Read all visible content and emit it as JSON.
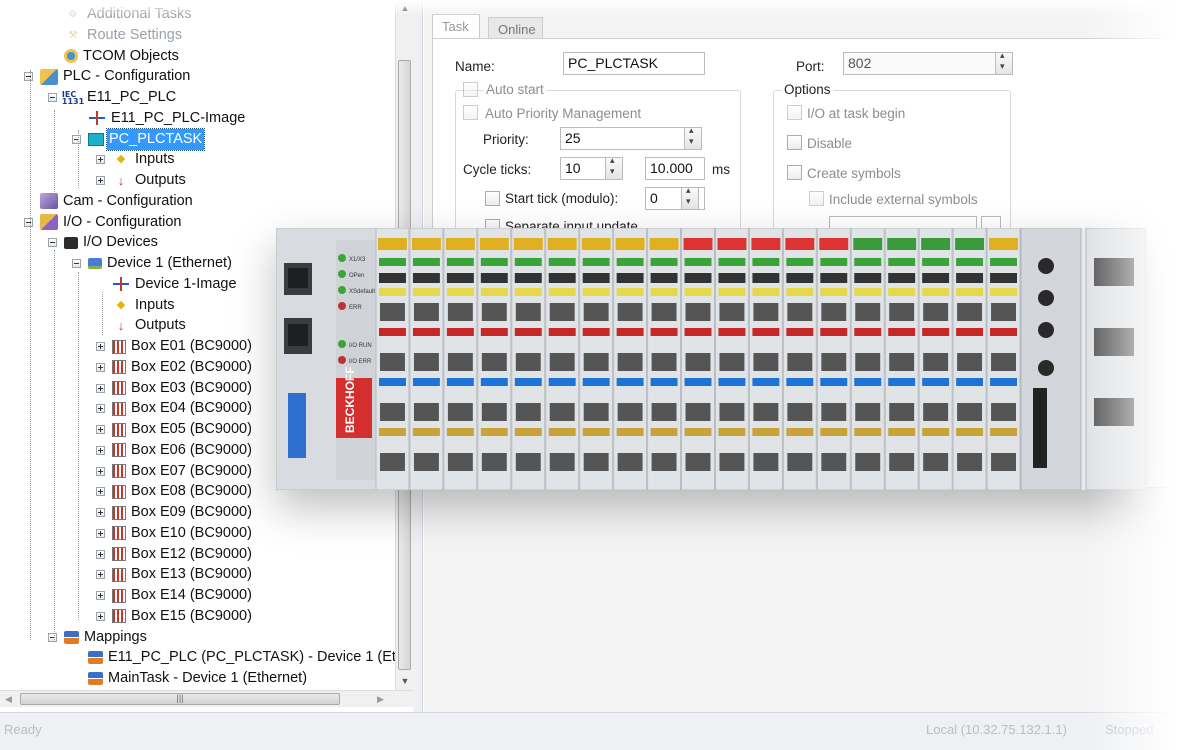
{
  "tree": {
    "items": [
      {
        "label": "Additional Tasks",
        "icon": "additional-tasks-icon"
      },
      {
        "label": "Route Settings",
        "icon": "route-settings-icon"
      },
      {
        "label": "TCOM Objects",
        "icon": "tcom-objects-icon"
      },
      {
        "label": "PLC - Configuration",
        "icon": "plc-configuration-icon"
      },
      {
        "label": "E11_PC_PLC",
        "icon": "iec-project-icon"
      },
      {
        "label": "E11_PC_PLC-Image",
        "icon": "process-image-icon"
      },
      {
        "label": "PC_PLCTASK",
        "icon": "plc-task-icon",
        "selected": true
      },
      {
        "label": "Inputs",
        "icon": "inputs-icon"
      },
      {
        "label": "Outputs",
        "icon": "outputs-icon"
      },
      {
        "label": "Cam - Configuration",
        "icon": "cam-configuration-icon"
      },
      {
        "label": "I/O - Configuration",
        "icon": "io-configuration-icon"
      },
      {
        "label": "I/O Devices",
        "icon": "io-devices-icon"
      },
      {
        "label": "Device 1 (Ethernet)",
        "icon": "ethernet-device-icon"
      },
      {
        "label": "Device 1-Image",
        "icon": "process-image-icon"
      },
      {
        "label": "Inputs",
        "icon": "inputs-icon"
      },
      {
        "label": "Outputs",
        "icon": "outputs-icon"
      },
      {
        "label": "Box E01 (BC9000)",
        "icon": "bus-coupler-icon"
      },
      {
        "label": "Box E02 (BC9000)",
        "icon": "bus-coupler-icon"
      },
      {
        "label": "Box E03 (BC9000)",
        "icon": "bus-coupler-icon"
      },
      {
        "label": "Box E04 (BC9000)",
        "icon": "bus-coupler-icon"
      },
      {
        "label": "Box E05 (BC9000)",
        "icon": "bus-coupler-icon"
      },
      {
        "label": "Box E06 (BC9000)",
        "icon": "bus-coupler-icon"
      },
      {
        "label": "Box E07 (BC9000)",
        "icon": "bus-coupler-icon"
      },
      {
        "label": "Box E08 (BC9000)",
        "icon": "bus-coupler-icon"
      },
      {
        "label": "Box E09 (BC9000)",
        "icon": "bus-coupler-icon"
      },
      {
        "label": "Box E10 (BC9000)",
        "icon": "bus-coupler-icon"
      },
      {
        "label": "Box E12 (BC9000)",
        "icon": "bus-coupler-icon"
      },
      {
        "label": "Box E13 (BC9000)",
        "icon": "bus-coupler-icon"
      },
      {
        "label": "Box E14 (BC9000)",
        "icon": "bus-coupler-icon"
      },
      {
        "label": "Box E15 (BC9000)",
        "icon": "bus-coupler-icon"
      },
      {
        "label": "Mappings",
        "icon": "mappings-icon"
      },
      {
        "label": "E11_PC_PLC (PC_PLCTASK) - Device 1 (Eth",
        "icon": "mapping-icon"
      },
      {
        "label": "MainTask - Device 1 (Ethernet)",
        "icon": "mapping-icon"
      }
    ]
  },
  "tabs": [
    {
      "label": "Task",
      "active": true
    },
    {
      "label": "Online",
      "active": false
    }
  ],
  "form": {
    "name_label": "Name:",
    "name_value": "PC_PLCTASK",
    "port_label": "Port:",
    "port_value": "802",
    "auto_start_label": "Auto start",
    "auto_priority_label": "Auto Priority Management",
    "priority_label": "Priority:",
    "priority_value": "25",
    "cycle_ticks_label": "Cycle ticks:",
    "cycle_ticks_value": "10",
    "cycle_time_value": "10.000",
    "cycle_time_unit": "ms",
    "start_tick_label": "Start tick (modulo):",
    "start_tick_value": "0",
    "separate_input_label": "Separate input update",
    "options_title": "Options",
    "io_at_task_begin_label": "I/O at task begin",
    "disable_label": "Disable",
    "create_symbols_label": "Create symbols",
    "include_external_label": "Include external symbols"
  },
  "status": {
    "ready": "Ready",
    "local": "Local (10.32.75.132.1.1)",
    "stopped": "Stopped"
  },
  "photo": {
    "brand": "BECKHOFF",
    "led_labels": [
      "X1/X3",
      "OPen",
      "XSdefault",
      "ERR",
      "I/O RUN",
      "I/O ERR"
    ],
    "terminal_count": 19
  }
}
